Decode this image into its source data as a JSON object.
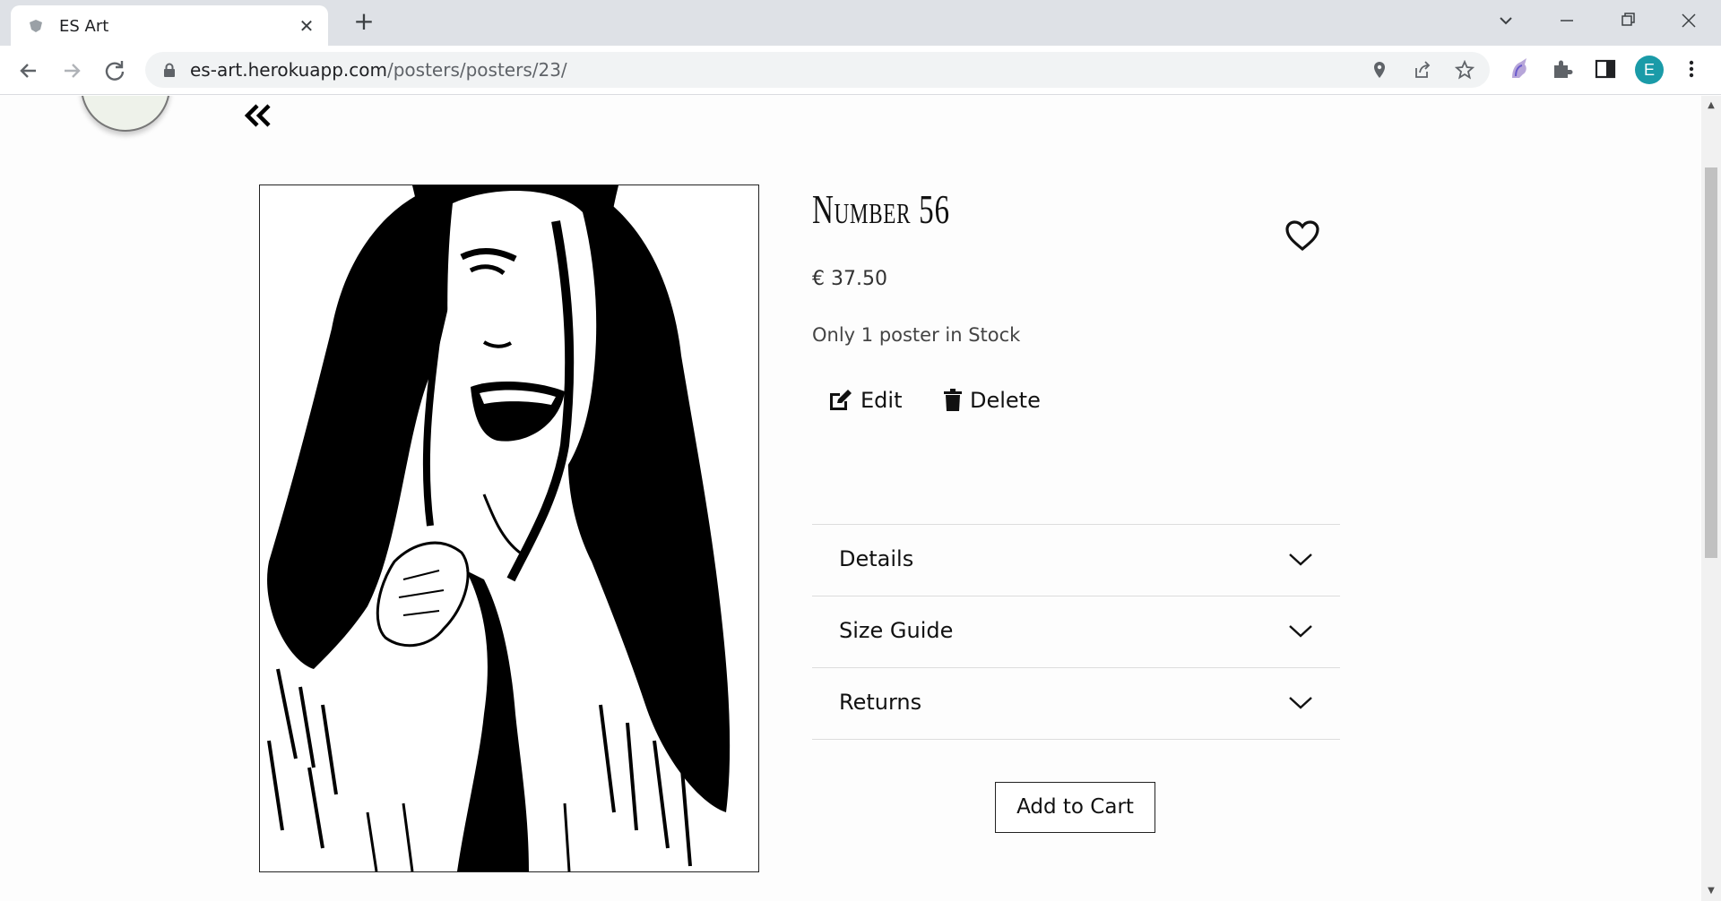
{
  "browser": {
    "tab_title": "ES Art",
    "url_host": "es-art.herokuapp.com",
    "url_path": "/posters/posters/23/",
    "profile_initial": "E"
  },
  "product": {
    "title": "Number 56",
    "price": "€ 37.50",
    "stock": "Only 1 poster in Stock",
    "edit_label": "Edit",
    "delete_label": "Delete",
    "accordion": [
      {
        "label": "Details"
      },
      {
        "label": "Size Guide"
      },
      {
        "label": "Returns"
      }
    ],
    "add_to_cart_label": "Add to Cart"
  },
  "icons": {
    "back": "double-chevron-left-icon",
    "wishlist": "heart-outline-icon",
    "edit": "edit-square-icon",
    "delete": "trash-icon",
    "expand": "chevron-down-icon"
  },
  "colors": {
    "profile_badge": "#1a9ba8",
    "logo_background": "#eef2ea"
  }
}
